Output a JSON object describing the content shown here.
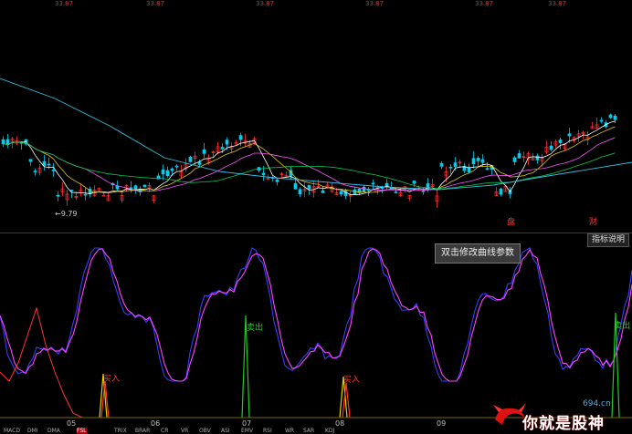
{
  "top_labels": [
    "33.87",
    "33.87",
    "33.87",
    "33.87",
    "33.87",
    "33.87"
  ],
  "colors": {
    "ma1": "#ffffff",
    "ma2": "#e6c800",
    "ma3": "#ff55ff",
    "ma4": "#00cc55",
    "ma5": "#33bbdd",
    "up": "#ff3333",
    "down": "#00ccee",
    "k": "#3b3bff",
    "d": "#ff44ff",
    "buy": "#e6d200",
    "sell": "#22cc22",
    "red": "#ff3333"
  },
  "price": {
    "low_label": "←9.79",
    "badges": [
      "盘",
      "财"
    ]
  },
  "indicator": {
    "button_label": "指标说明",
    "tooltip": "双击修改曲线参数",
    "sell_label": "卖出",
    "buy_label": "买入"
  },
  "x_axis": {
    "ticks": [
      "05",
      "06",
      "07",
      "08",
      "09"
    ]
  },
  "tabs": [
    "MACD",
    "DMI",
    "DMA",
    "FSL",
    "TRIX",
    "BRAR",
    "CR",
    "VR",
    "OBV",
    "ASI",
    "EMV",
    "RSI",
    "WR",
    "SAR",
    "KDJ"
  ],
  "watermark": {
    "text": "你就是股神",
    "site": "694.cn"
  }
}
